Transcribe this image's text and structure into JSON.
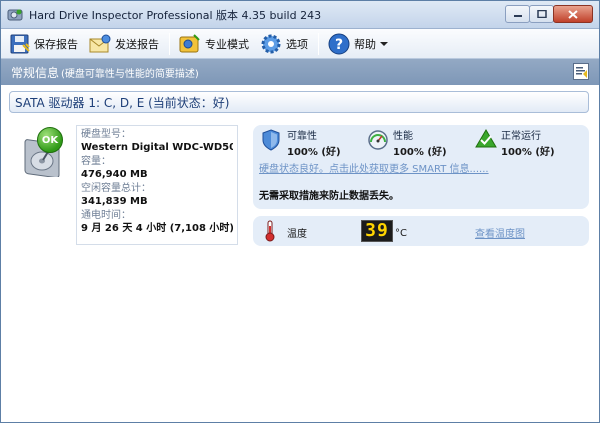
{
  "window": {
    "title": "Hard Drive Inspector Professional 版本 4.35 build 243"
  },
  "toolbar": {
    "save_report": "保存报告",
    "send_report": "发送报告",
    "expert_mode": "专业模式",
    "options": "选项",
    "help": "帮助"
  },
  "section": {
    "title": "常规信息",
    "description": "(硬盘可靠性与性能的简要描述)"
  },
  "drive": {
    "header": "SATA 驱动器 1: C, D, E (当前状态：好)",
    "status_badge": "OK",
    "model_label": "硬盘型号：",
    "model_value": "Western Digital WDC-WD50...",
    "capacity_label": "容量：",
    "capacity_value": "476,940 MB",
    "free_label": "空闲容量总计：",
    "free_value": "341,839 MB",
    "uptime_label": "通电时间：",
    "uptime_value": "9 月 26 天 4 小时 (7,108 小时)？"
  },
  "health": {
    "reliability_label": "可靠性",
    "reliability_value": "100% (好)",
    "performance_label": "性能",
    "performance_value": "100% (好)",
    "errors_label": "正常运行",
    "errors_value": "100% (好)",
    "smart_link": "硬盘状态良好。点击此处获取更多 SMART 信息......",
    "advice": "无需采取措施来防止数据丢失。"
  },
  "temperature": {
    "label": "温度",
    "value": "39",
    "unit": "°C",
    "history_link": "查看温度图"
  }
}
